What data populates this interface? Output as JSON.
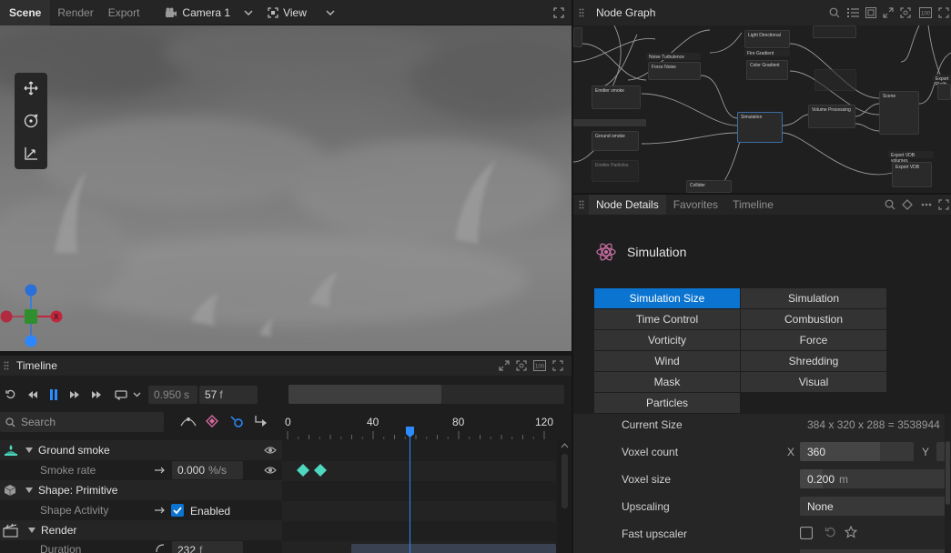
{
  "top_bar": {
    "tabs": [
      {
        "label": "Scene"
      },
      {
        "label": "Render"
      },
      {
        "label": "Export"
      }
    ],
    "camera_label": "Camera 1",
    "view_label": "View"
  },
  "node_graph": {
    "title": "Node Graph",
    "nodes": {
      "light_directional": "Light Directional",
      "fire_gradient": "Fire Gradient",
      "color_gradient": "Color Gradient",
      "noise_turbulence": "Noise Turbulence",
      "force_noise": "Force Noise",
      "emitter_smoke": "Emitter smoke",
      "simulation": "Simulation",
      "volume_processing": "Volume Processing",
      "scene": "Scene",
      "ground_smoke": "Ground smoke",
      "export_vdb_volumes": "Export VDB volumes",
      "export_vdb": "Export VDB",
      "collider": "Collider",
      "emitter_particles": "Emitter Particles",
      "export_playback": "Export Playb"
    }
  },
  "node_details": {
    "tabs": [
      {
        "label": "Node Details"
      },
      {
        "label": "Favorites"
      },
      {
        "label": "Timeline"
      }
    ],
    "node_title": "Simulation",
    "sections_left": [
      "Simulation Size",
      "Time Control",
      "Vorticity",
      "Wind",
      "Mask",
      "Particles"
    ],
    "sections_right": [
      "Simulation",
      "Combustion",
      "Force",
      "Shredding",
      "Visual"
    ],
    "properties": {
      "current_size_label": "Current Size",
      "current_size_value": "384 x 320 x 288 = 3538944",
      "voxel_count_label": "Voxel count",
      "voxel_count_axis_x": "X",
      "voxel_count_value": "360",
      "voxel_count_axis_y": "Y",
      "voxel_size_label": "Voxel size",
      "voxel_size_value": "0.200",
      "voxel_size_unit": "m",
      "upscaling_label": "Upscaling",
      "upscaling_value": "None",
      "fast_upscaler_label": "Fast upscaler"
    }
  },
  "timeline": {
    "title": "Timeline",
    "time_seconds": "0.950",
    "time_unit_s": "s",
    "frame": "57",
    "frame_unit": "f",
    "search_placeholder": "Search",
    "ruler_ticks": [
      "0",
      "40",
      "80",
      "120"
    ],
    "playhead_frame": 57,
    "tracks": {
      "ground_smoke": "Ground smoke",
      "smoke_rate": "Smoke rate",
      "smoke_rate_value": "0.000",
      "smoke_rate_unit": "%/s",
      "shape_primitive": "Shape: Primitive",
      "shape_activity": "Shape Activity",
      "shape_activity_value": "Enabled",
      "render": "Render",
      "duration": "Duration",
      "duration_value": "232",
      "duration_unit": "f"
    }
  },
  "colors": {
    "accent_blue": "#0a74d0",
    "keyframe_teal": "#4fd8c0",
    "axis_x_red": "#c0263d",
    "axis_y_green": "#2f8f2f",
    "axis_z_blue": "#2b6fd8"
  }
}
